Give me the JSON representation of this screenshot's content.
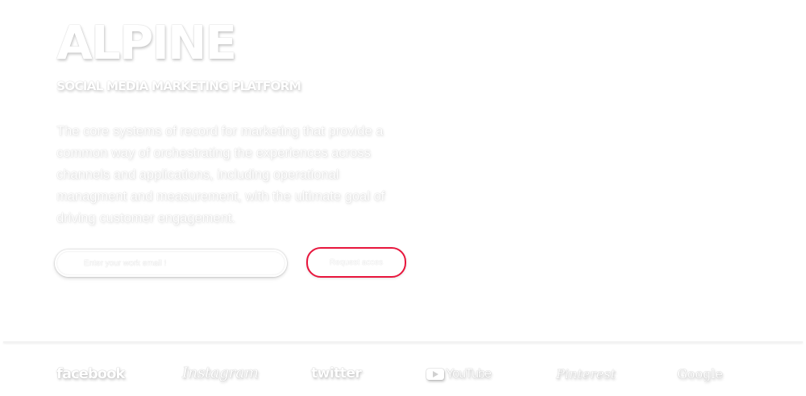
{
  "hero": {
    "brand": "ALPINE",
    "tagline": "SOCIAL MEDIA MARKETING PLATFORM",
    "description": "The core systems of record for marketing that provide a common way of orchestrating the experiences across channels and applications, including operational managment and measurement, with the ultimate goal of driving customer engagement."
  },
  "form": {
    "email_placeholder": "Enter your work email !",
    "email_value": "",
    "request_label": "Request acces"
  },
  "logos": [
    {
      "label": "facebook",
      "icon": "facebook-logo"
    },
    {
      "label": "Instagram",
      "icon": "instagram-logo"
    },
    {
      "label": "twitter",
      "icon": "twitter-logo"
    },
    {
      "label": "YouTube",
      "icon": "youtube-logo"
    },
    {
      "label": "Pinterest",
      "icon": "pinterest-logo"
    },
    {
      "label": "Google",
      "icon": "google-logo"
    }
  ],
  "colors": {
    "background": "#ffffff",
    "text": "#ffffff",
    "accent": "#e8163d",
    "divider": "#f2f2f2"
  }
}
